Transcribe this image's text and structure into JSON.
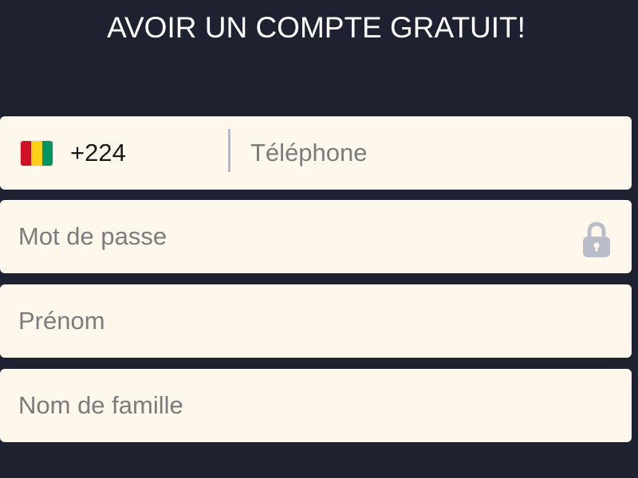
{
  "title": "AVOIR UN COMPTE GRATUIT!",
  "phone": {
    "flag_colors": [
      "#ce1126",
      "#fcd116",
      "#009460"
    ],
    "dial_code": "+224",
    "placeholder": "Téléphone"
  },
  "password": {
    "placeholder": "Mot de passe",
    "icon": "lock-icon"
  },
  "first_name": {
    "placeholder": "Prénom"
  },
  "last_name": {
    "placeholder": "Nom de famille"
  },
  "colors": {
    "background": "#1e2130",
    "field_background": "#fdf7ec",
    "icon": "#b9bdc9"
  }
}
